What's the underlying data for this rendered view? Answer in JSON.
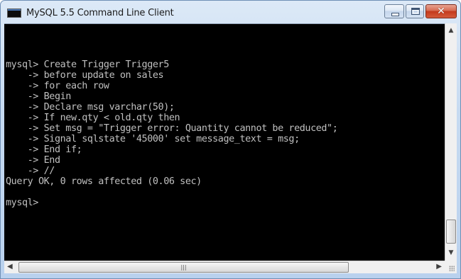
{
  "window": {
    "title": "MySQL 5.5 Command Line Client",
    "app_icon": "console-window-icon",
    "controls": {
      "minimize_icon": "minimize-icon",
      "maximize_icon": "maximize-icon",
      "close_icon": "close-icon",
      "close_glyph": "✕"
    }
  },
  "console": {
    "lines": [
      "mysql> Create Trigger Trigger5",
      "    -> before update on sales",
      "    -> for each row",
      "    -> Begin",
      "    -> Declare msg varchar(50);",
      "    -> If new.qty < old.qty then",
      "    -> Set msg = \"Trigger error: Quantity cannot be reduced\";",
      "    -> Signal sqlstate '45000' set message_text = msg;",
      "    -> End if;",
      "    -> End",
      "    -> //",
      "Query OK, 0 rows affected (0.06 sec)",
      "",
      "mysql>"
    ]
  },
  "scrollbars": {
    "up_arrow": "▲",
    "down_arrow": "▼",
    "left_arrow": "◀",
    "right_arrow": "▶",
    "grip": "|||"
  },
  "colors": {
    "console_bg": "#000000",
    "console_text": "#c0c0c0",
    "close_button": "#c3391c"
  }
}
